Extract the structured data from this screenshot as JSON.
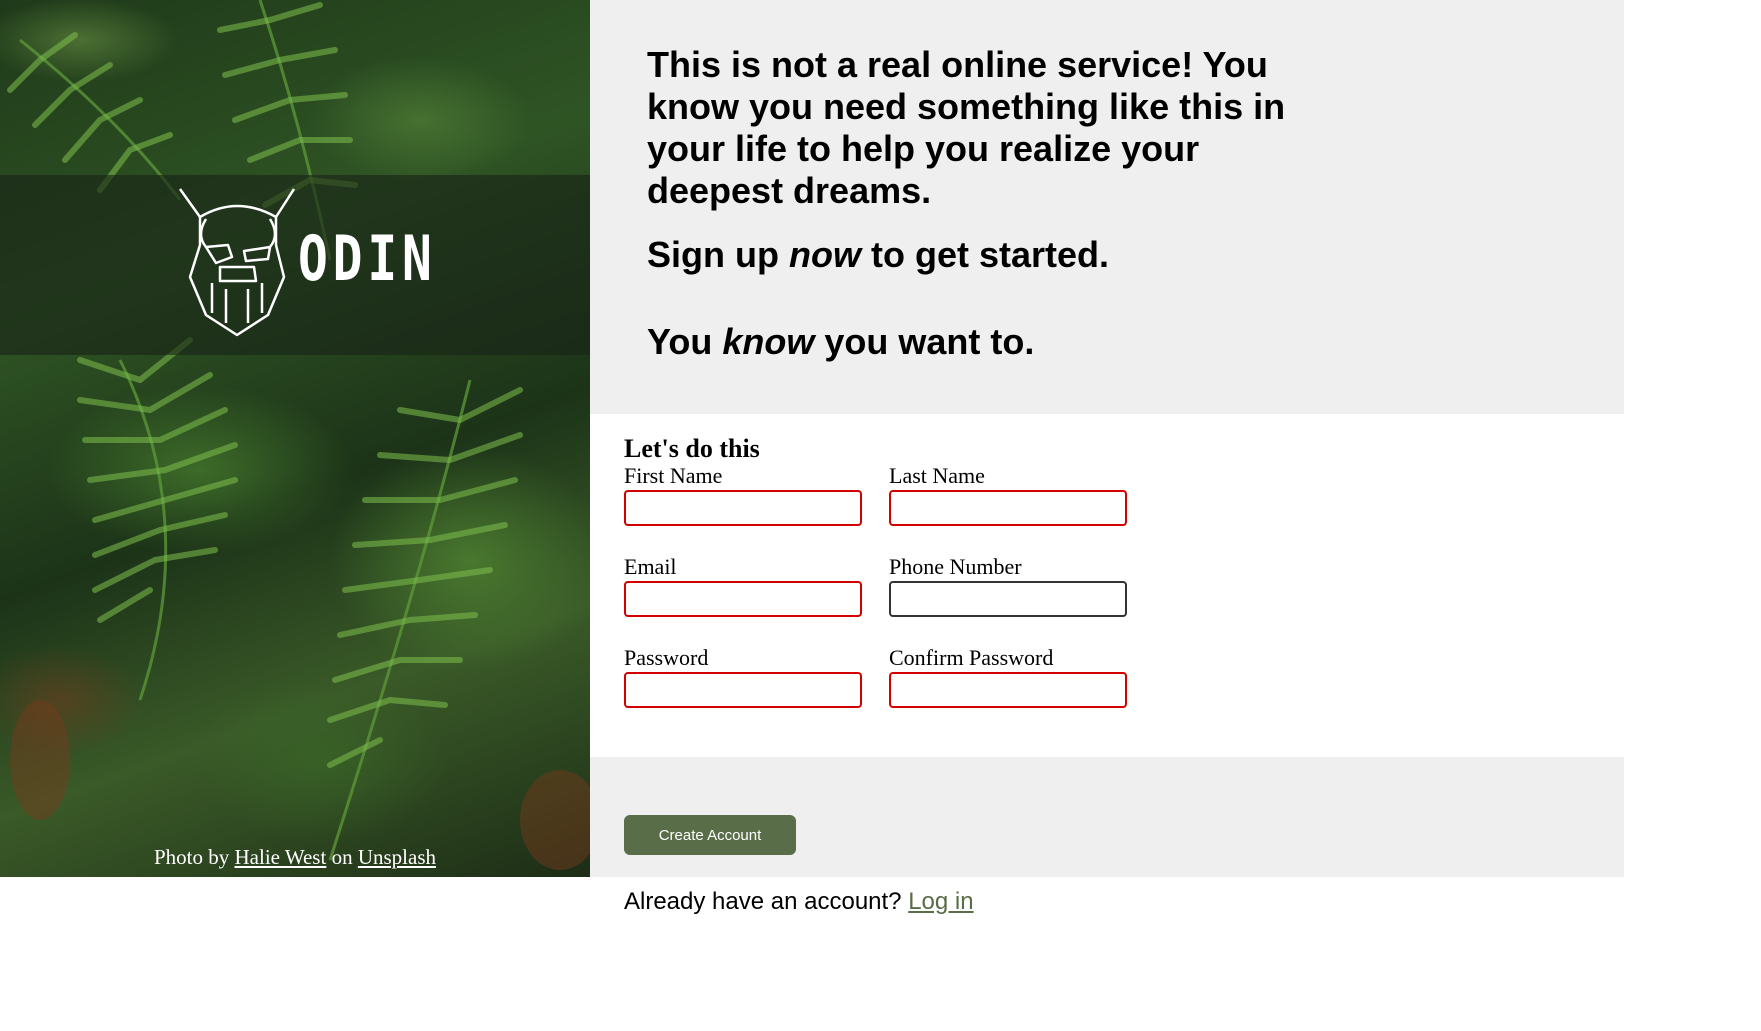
{
  "sidebar": {
    "logo_text": "ODIN",
    "credit": {
      "prefix": "Photo by ",
      "author": "Halie West",
      "middle": " on ",
      "source": "Unsplash"
    }
  },
  "intro": {
    "line1": "This is not a real online service! You know you need something like this in your life to help you realize your deepest dreams.",
    "signup_before": "Sign up ",
    "signup_em": "now",
    "signup_after": " to get started.",
    "want_before": "You ",
    "want_em": "know",
    "want_after": " you want to."
  },
  "form": {
    "title": "Let's do this",
    "fields": {
      "first_name": "First Name",
      "last_name": "Last Name",
      "email": "Email",
      "phone": "Phone Number",
      "password": "Password",
      "confirm_password": "Confirm Password"
    }
  },
  "footer": {
    "create_button": "Create Account",
    "login_prompt": "Already have an account? ",
    "login_link": "Log in"
  },
  "colors": {
    "accent": "#596d48",
    "invalid_border": "#d40000",
    "panel_bg": "#efefef"
  }
}
